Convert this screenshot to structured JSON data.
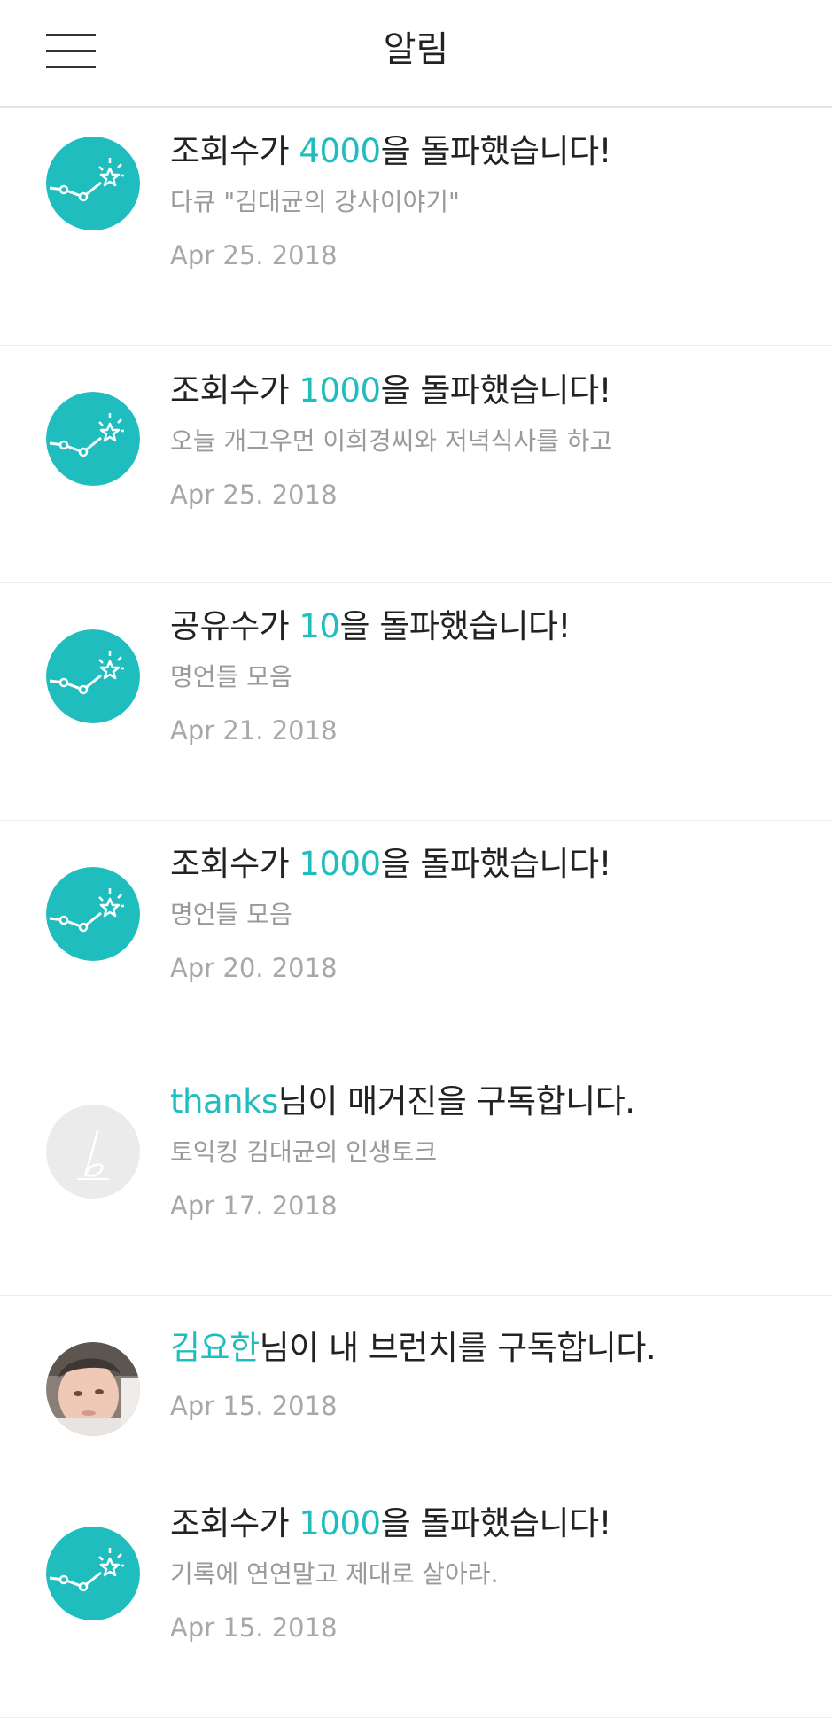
{
  "header": {
    "title": "알림"
  },
  "colors": {
    "accent": "#20bdbf",
    "title_text": "#222222",
    "sub_text": "#9a9a9a",
    "date_text": "#a8a8a8",
    "divider": "#ececec"
  },
  "notifications": [
    {
      "icon": "stats-milestone-icon",
      "prefix": "조회수가 ",
      "highlight": "4000",
      "suffix": "을 돌파했습니다!",
      "subtitle": "다큐 \"김대균의 강사이야기\"",
      "date": "Apr 25. 2018"
    },
    {
      "icon": "stats-milestone-icon",
      "prefix": "조회수가 ",
      "highlight": "1000",
      "suffix": "을 돌파했습니다!",
      "subtitle": "오늘 개그우먼 이희경씨와 저녁식사를 하고",
      "date": "Apr 25. 2018"
    },
    {
      "icon": "stats-milestone-icon",
      "prefix": "공유수가 ",
      "highlight": "10",
      "suffix": "을 돌파했습니다!",
      "subtitle": "명언들 모음",
      "date": "Apr 21. 2018"
    },
    {
      "icon": "stats-milestone-icon",
      "prefix": "조회수가 ",
      "highlight": "1000",
      "suffix": "을 돌파했습니다!",
      "subtitle": "명언들 모음",
      "date": "Apr 20. 2018"
    },
    {
      "icon": "default-profile-avatar",
      "prefix": "",
      "highlight": "thanks",
      "suffix": "님이 매거진을 구독합니다.",
      "subtitle": "토익킹 김대균의 인생토크",
      "date": "Apr 17. 2018"
    },
    {
      "icon": "user-photo-avatar",
      "prefix": "",
      "highlight": "김요한",
      "suffix": "님이 내 브런치를 구독합니다.",
      "date": "Apr 15. 2018"
    },
    {
      "icon": "stats-milestone-icon",
      "prefix": "조회수가 ",
      "highlight": "1000",
      "suffix": "을 돌파했습니다!",
      "subtitle": "기록에 연연말고 제대로 살아라.",
      "date": "Apr 15. 2018"
    }
  ]
}
